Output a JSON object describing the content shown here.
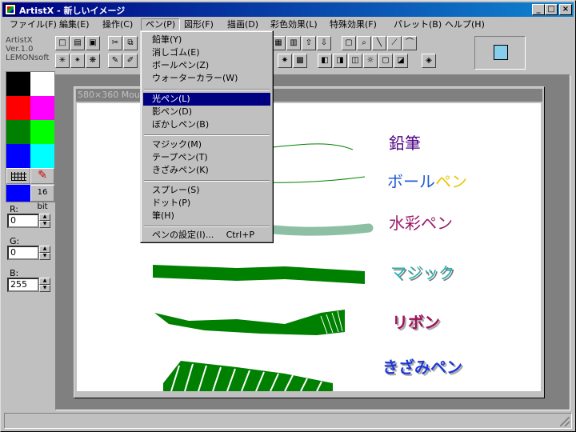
{
  "window": {
    "title": "ArtistX - 新しいイメージ"
  },
  "menubar": [
    {
      "label": "ファイル(F)"
    },
    {
      "label": "編集(E)"
    },
    {
      "label": "操作(C)"
    },
    {
      "label": "ペン(P)"
    },
    {
      "label": "図形(F)"
    },
    {
      "label": "描画(D)"
    },
    {
      "label": "彩色効果(L)"
    },
    {
      "label": "特殊効果(F)"
    },
    {
      "label": "パレット(B)"
    },
    {
      "label": "ヘルプ(H)"
    }
  ],
  "app_info": {
    "name": "ArtistX",
    "version": "Ver.1.0",
    "author": "LEMONsoft"
  },
  "palette": {
    "colors": [
      "#000000",
      "#ffffff",
      "#ff0000",
      "#ff00ff",
      "#008000",
      "#00ff00",
      "#0000ff",
      "#00ffff"
    ],
    "current": "#0000ff",
    "bit_label": "16 bit"
  },
  "rgb": {
    "r_label": "R:",
    "r_value": "0",
    "g_label": "G:",
    "g_value": "0",
    "b_label": "B:",
    "b_value": "255"
  },
  "document": {
    "title": "580×360 Mouse"
  },
  "pen_menu": {
    "group1": [
      {
        "label": "鉛筆(Y)"
      },
      {
        "label": "消しゴム(E)"
      },
      {
        "label": "ボールペン(Z)"
      },
      {
        "label": "ウォーターカラー(W)"
      }
    ],
    "group2": [
      {
        "label": "光ペン(L)"
      },
      {
        "label": "影ペン(D)"
      },
      {
        "label": "ぼかしペン(B)"
      }
    ],
    "group3": [
      {
        "label": "マジック(M)"
      },
      {
        "label": "テープペン(T)"
      },
      {
        "label": "きざみペン(K)"
      }
    ],
    "group4": [
      {
        "label": "スプレー(S)"
      },
      {
        "label": "ドット(P)"
      },
      {
        "label": "筆(H)"
      }
    ],
    "settings": {
      "label": "ペンの設定(I)...",
      "shortcut": "Ctrl+P"
    }
  },
  "canvas_labels": {
    "pencil": "鉛筆",
    "ballpen_a": "ボール",
    "ballpen_b": "ペン",
    "watercolor": "水彩ペン",
    "magic": "マジック",
    "ribbon": "リボン",
    "kizami": "きざみペン"
  },
  "colors": {
    "selection": "#000080",
    "preview": "#87ceeb",
    "stroke_green": "#008000"
  }
}
